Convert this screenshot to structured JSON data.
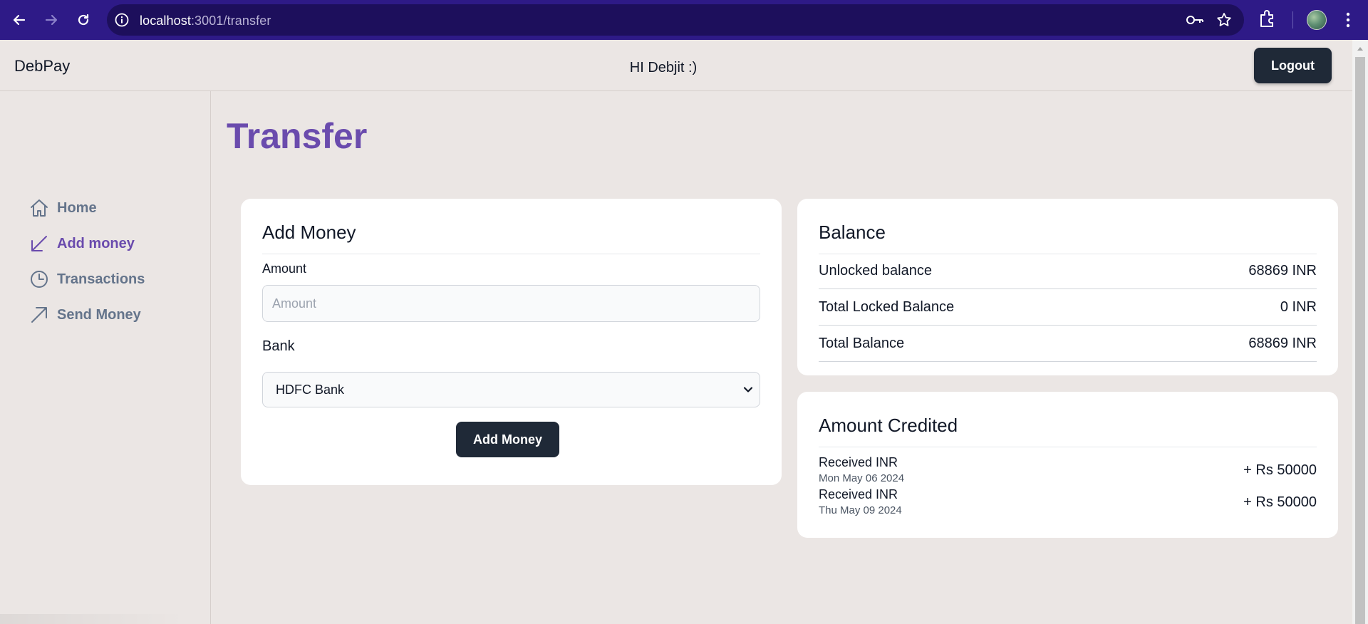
{
  "browser": {
    "url_host": "localhost",
    "url_rest": ":3001/transfer"
  },
  "app": {
    "brand": "DebPay",
    "greeting": "HI Debjit :)",
    "logout_label": "Logout"
  },
  "sidebar": {
    "items": [
      {
        "label": "Home",
        "icon": "home-icon",
        "active": false
      },
      {
        "label": "Add money",
        "icon": "arrow-down-left-icon",
        "active": true
      },
      {
        "label": "Transactions",
        "icon": "clock-icon",
        "active": false
      },
      {
        "label": "Send Money",
        "icon": "arrow-up-right-icon",
        "active": false
      }
    ]
  },
  "main": {
    "title": "Transfer",
    "add_money": {
      "title": "Add Money",
      "amount_label": "Amount",
      "amount_placeholder": "Amount",
      "amount_value": "",
      "bank_label": "Bank",
      "bank_selected": "HDFC Bank",
      "submit_label": "Add Money"
    },
    "balance": {
      "title": "Balance",
      "rows": [
        {
          "label": "Unlocked balance",
          "value": "68869 INR"
        },
        {
          "label": "Total Locked Balance",
          "value": "0 INR"
        },
        {
          "label": "Total Balance",
          "value": "68869 INR"
        }
      ]
    },
    "credited": {
      "title": "Amount Credited",
      "transactions": [
        {
          "title": "Received INR",
          "date": "Mon May 06 2024",
          "amount": "+ Rs 50000"
        },
        {
          "title": "Received INR",
          "date": "Thu May 09 2024",
          "amount": "+ Rs 50000"
        }
      ]
    }
  },
  "colors": {
    "accent": "#6a4bad",
    "chrome": "#2e1a87",
    "button": "#1f2937",
    "background": "#ebe6e4"
  }
}
